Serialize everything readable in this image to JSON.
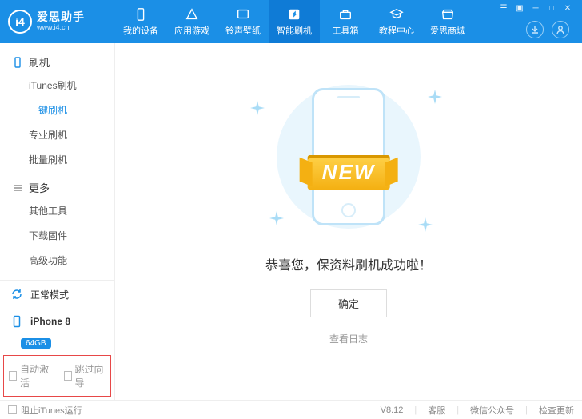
{
  "brand": {
    "logo_text": "i4",
    "title": "爱思助手",
    "subtitle": "www.i4.cn"
  },
  "nav": {
    "items": [
      {
        "label": "我的设备",
        "icon": "device-icon"
      },
      {
        "label": "应用游戏",
        "icon": "apps-icon"
      },
      {
        "label": "铃声壁纸",
        "icon": "media-icon"
      },
      {
        "label": "智能刷机",
        "icon": "flash-icon",
        "active": true
      },
      {
        "label": "工具箱",
        "icon": "toolbox-icon"
      },
      {
        "label": "教程中心",
        "icon": "tutorial-icon"
      },
      {
        "label": "爱思商城",
        "icon": "store-icon"
      }
    ]
  },
  "sidebar": {
    "groups": [
      {
        "title": "刷机",
        "items": [
          "iTunes刷机",
          "一键刷机",
          "专业刷机",
          "批量刷机"
        ],
        "activeIndex": 1
      },
      {
        "title": "更多",
        "items": [
          "其他工具",
          "下载固件",
          "高级功能"
        ],
        "activeIndex": -1
      }
    ],
    "mode": {
      "label": "正常模式"
    },
    "device": {
      "name": "iPhone 8",
      "badge": "64GB"
    },
    "checks": {
      "auto_activate": "自动激活",
      "skip_guide": "跳过向导"
    }
  },
  "main": {
    "ribbon": "NEW",
    "message": "恭喜您，保资料刷机成功啦！",
    "confirm": "确定",
    "view_log": "查看日志"
  },
  "footer": {
    "block_itunes": "阻止iTunes运行",
    "version": "V8.12",
    "support": "客服",
    "wechat": "微信公众号",
    "update": "检查更新"
  }
}
